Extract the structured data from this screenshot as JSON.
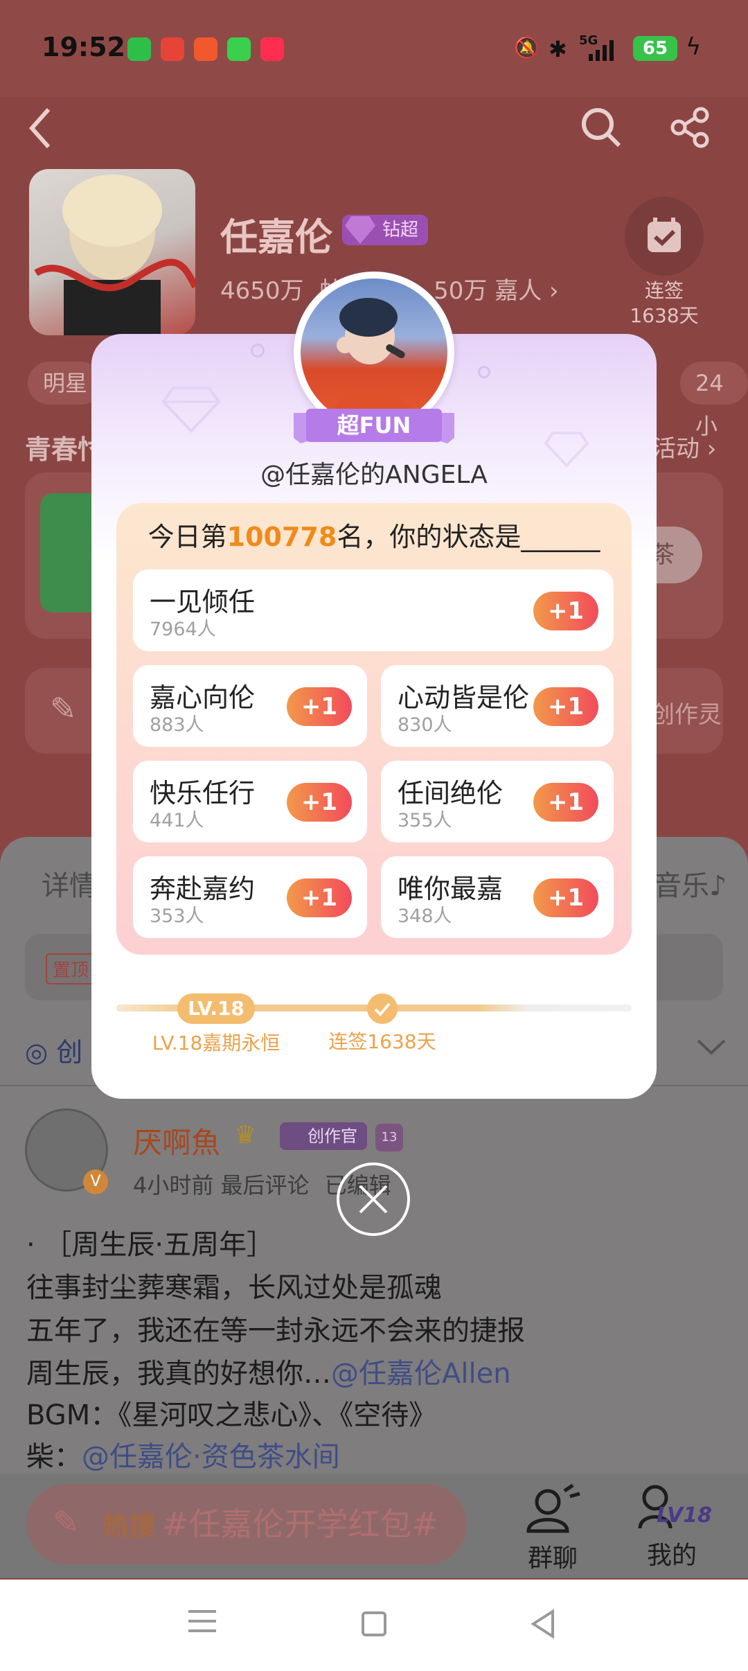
{
  "status_bar": {
    "time": "19:52",
    "network": "5G",
    "battery": "65"
  },
  "header": {
    "back_icon": "chevron-left-icon",
    "search_icon": "search-icon",
    "share_icon": "share-icon"
  },
  "profile": {
    "name": "任嘉伦",
    "badge": "钻超",
    "stats_partial_left": "4650万",
    "stats_partial_mid": "帖",
    "stats_partial_right": "50万",
    "stats_fans_label": "嘉人",
    "sign_label": "连签",
    "sign_days": "1638天"
  },
  "background": {
    "chip_left": "明星",
    "chip_right": "24小",
    "section_left": "青春忖",
    "section_right": "活动",
    "card_button": "茶",
    "creation_right": "创作灵",
    "tab_left": "详情",
    "tab_right": "音乐",
    "pinned": "置顶",
    "create_prefix": "创"
  },
  "post": {
    "author": "厌啊魚",
    "creator_badge": "创作官",
    "level_badge": "13",
    "meta": "4小时前 最后评论",
    "edited": "已编辑",
    "lines": [
      "· ［周生辰·五周年］",
      "往事封尘葬寒霜，长风过处是孤魂",
      "五年了，我还在等一封永远不会来的捷报"
    ],
    "line4_text": "周生辰，我真的好想你…",
    "line4_link": "@任嘉伦Allen",
    "line5": "BGM：《星河叹之悲心》、《空待》",
    "line6_text": "柴：",
    "line6_link": "@任嘉伦·资色茶水间"
  },
  "bottom_bar": {
    "hot_label": "热搜",
    "hot_topic": "#任嘉伦开学红包#",
    "group_chat": "群聊",
    "mine": "我的",
    "mine_level": "LV18"
  },
  "modal": {
    "rank_title": "超FUN",
    "handle": "@任嘉伦的ANGELA",
    "question_prefix": "今日第",
    "rank_number": "100778",
    "question_suffix": "名，你的状态是______",
    "plus_label": "+1",
    "options": [
      {
        "title": "一见倾任",
        "count": "7964人"
      },
      {
        "title": "嘉心向伦",
        "count": "883人"
      },
      {
        "title": "心动皆是伦",
        "count": "830人"
      },
      {
        "title": "快乐任行",
        "count": "441人"
      },
      {
        "title": "任间绝伦",
        "count": "355人"
      },
      {
        "title": "奔赴嘉约",
        "count": "353人"
      },
      {
        "title": "唯你最嘉",
        "count": "348人"
      }
    ],
    "level_pill": "LV.18",
    "level_caption": "LV.18嘉期永恒",
    "sign_caption": "连签1638天"
  },
  "colors": {
    "accent_orange": "#f08a1a",
    "plus_gradient_start": "#f2994a",
    "plus_gradient_end": "#f24b5b",
    "ribbon_purple": "#b57be8",
    "overlay_tint": "#8a4543"
  }
}
